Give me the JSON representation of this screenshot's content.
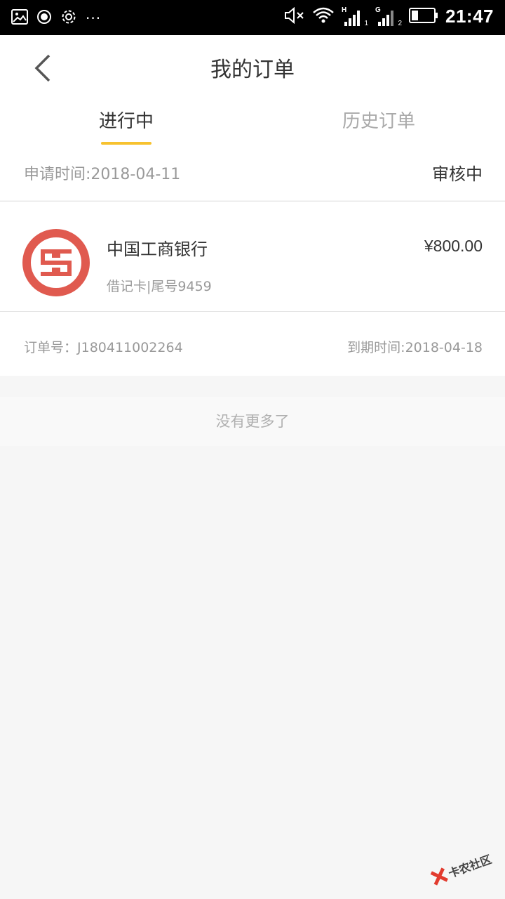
{
  "status_bar": {
    "left_icons": [
      "image-icon",
      "record-icon",
      "settings-icon",
      "more-dots-icon"
    ],
    "more_dots": "···",
    "sim1_tag": "H",
    "sim1_sub": "1",
    "sim2_tag": "G",
    "sim2_sub": "2",
    "battery_level": 0.3,
    "time": "21:47"
  },
  "header": {
    "title": "我的订单"
  },
  "tabs": [
    {
      "label": "进行中",
      "active": true
    },
    {
      "label": "历史订单",
      "active": false
    }
  ],
  "order": {
    "apply_time": "申请时间:2018-04-11",
    "status": "审核中",
    "bank_name": "中国工商银行",
    "amount": "¥800.00",
    "card_info": "借记卡|尾号9459",
    "order_no": "订单号：J180411002264",
    "due_time": "到期时间:2018-04-18"
  },
  "list_end_text": "没有更多了",
  "colors": {
    "accent": "#f7c22f",
    "bank_red": "#e05a4f"
  },
  "watermark": {
    "text": "卡农社区"
  }
}
